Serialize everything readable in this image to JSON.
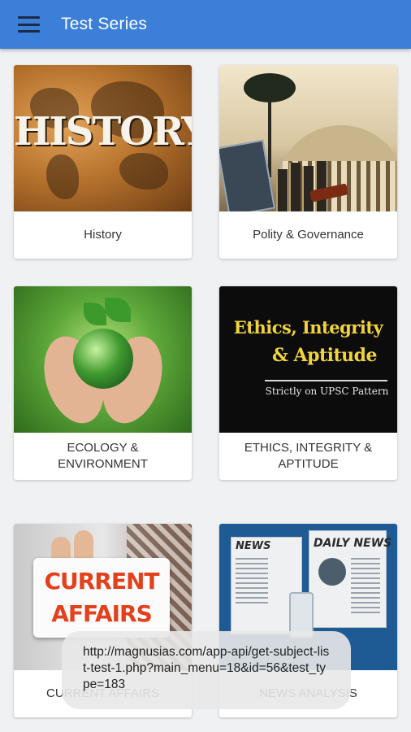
{
  "appbar": {
    "title": "Test Series",
    "menu_icon": "hamburger-menu-icon",
    "background": "#3b7fd9"
  },
  "cards": [
    {
      "label": "History",
      "thumb_text": "HISTORY"
    },
    {
      "label": "Polity & Governance"
    },
    {
      "label": "ECOLOGY & ENVIRONMENT"
    },
    {
      "label": "ETHICS, INTEGRITY & APTITUDE",
      "thumb_line1": "Ethics, Integrity",
      "thumb_line2": "& Aptitude",
      "thumb_sub": "Strictly on UPSC Pattern"
    },
    {
      "label": "CURRENT AFFAIRS",
      "thumb_line1": "CURRENT",
      "thumb_line2": "AFFAIRS"
    },
    {
      "label": "NEWS ANALYSIS",
      "thumb_news": "NEWS",
      "thumb_daily": "DAILY NEWS"
    }
  ],
  "toast": {
    "text": "http://magnusias.com/app-api/get-subject-list-test-1.php?main_menu=18&id=56&test_type=183"
  }
}
